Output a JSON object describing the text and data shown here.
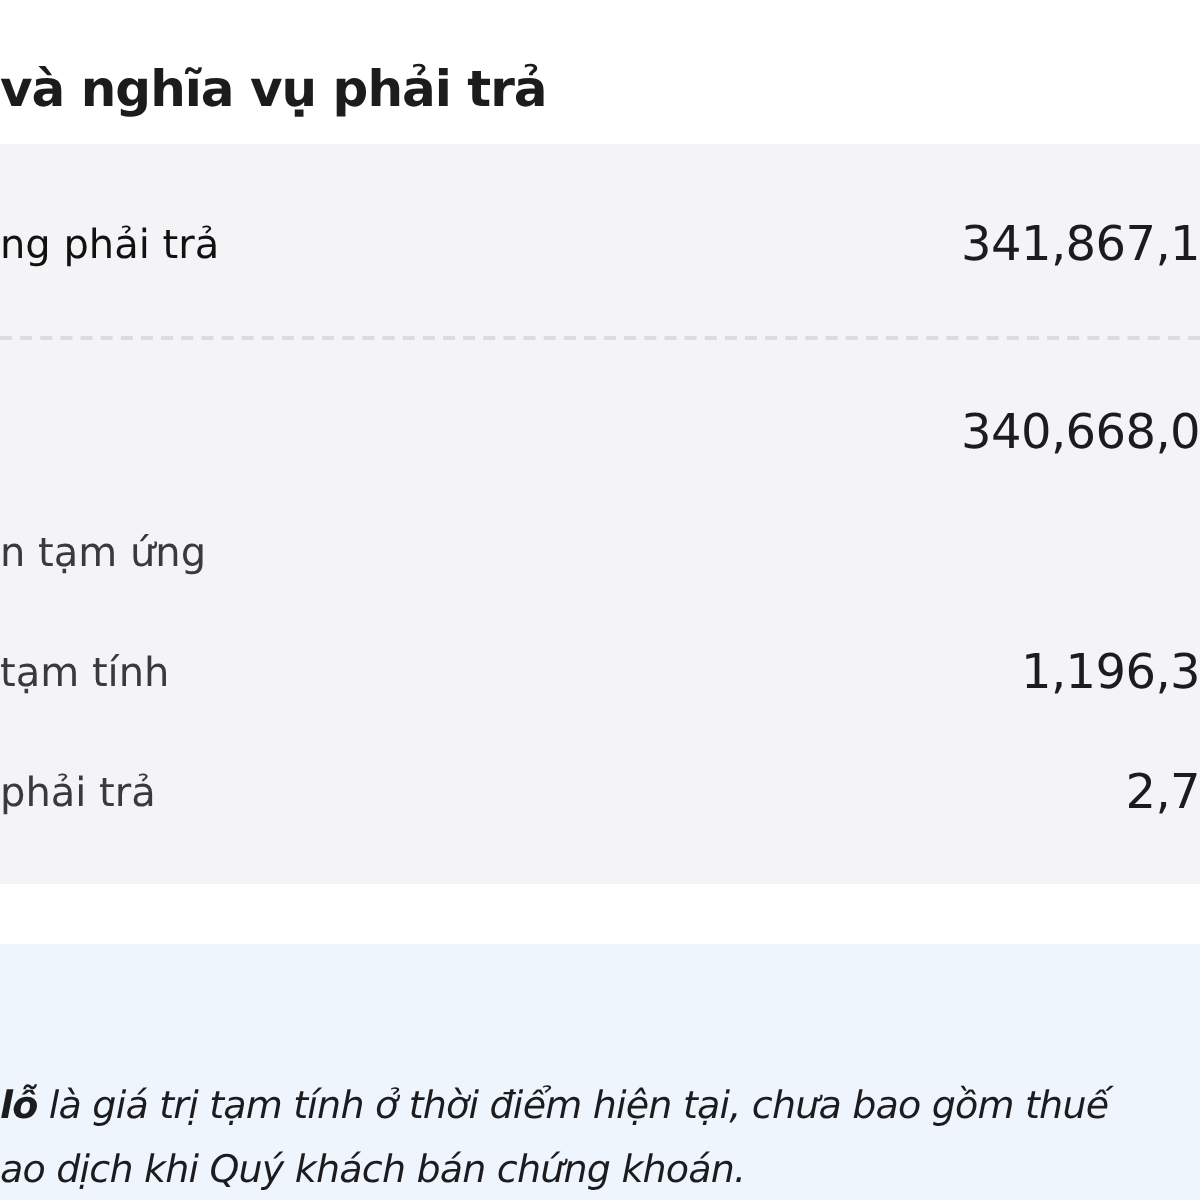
{
  "title": "và nghĩa vụ phải trả",
  "rows": [
    {
      "kind": "total",
      "label": "ng phải trả",
      "value": "341,867,1"
    },
    {
      "kind": "item",
      "value": "340,668,0"
    },
    {
      "kind": "item",
      "label": "n tạm ứng"
    },
    {
      "kind": "item",
      "label": "tạm tính",
      "value": "1,196,3"
    },
    {
      "kind": "item",
      "label": "phải trả",
      "value": "2,7"
    }
  ],
  "note": {
    "lines": [
      "**lỗ** là giá trị tạm tính ở thời điểm hiện tại, chưa bao gồm thuế",
      "ao dịch khi Quý khách bán chứng khoán."
    ]
  }
}
